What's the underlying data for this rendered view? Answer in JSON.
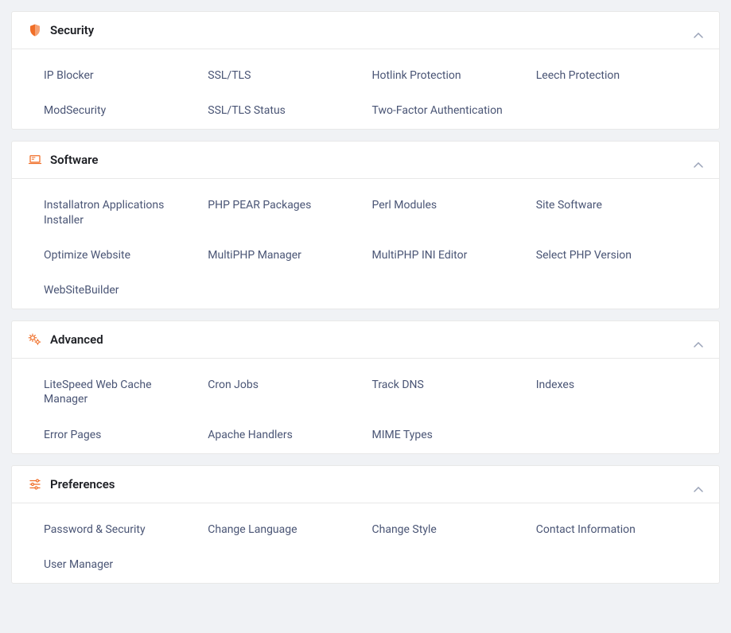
{
  "colors": {
    "accent": "#f06e27",
    "link": "#4a5575",
    "chevron": "#9aa3b8"
  },
  "sections": [
    {
      "id": "security",
      "icon": "shield-icon",
      "title": "Security",
      "items": [
        "IP Blocker",
        "SSL/TLS",
        "Hotlink Protection",
        "Leech Protection",
        "ModSecurity",
        "SSL/TLS Status",
        "Two-Factor Authentication"
      ]
    },
    {
      "id": "software",
      "icon": "laptop-icon",
      "title": "Software",
      "items": [
        "Installatron Applications Installer",
        "PHP PEAR Packages",
        "Perl Modules",
        "Site Software",
        "Optimize Website",
        "MultiPHP Manager",
        "MultiPHP INI Editor",
        "Select PHP Version",
        "WebSiteBuilder"
      ]
    },
    {
      "id": "advanced",
      "icon": "gears-icon",
      "title": "Advanced",
      "items": [
        "LiteSpeed Web Cache Manager",
        "Cron Jobs",
        "Track DNS",
        "Indexes",
        "Error Pages",
        "Apache Handlers",
        "MIME Types"
      ]
    },
    {
      "id": "preferences",
      "icon": "sliders-icon",
      "title": "Preferences",
      "items": [
        "Password & Security",
        "Change Language",
        "Change Style",
        "Contact Information",
        "User Manager"
      ]
    }
  ]
}
